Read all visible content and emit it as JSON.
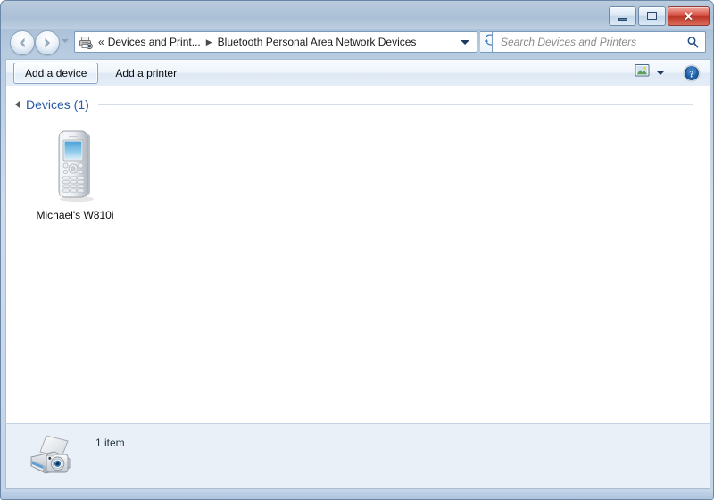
{
  "window": {
    "title": "",
    "controls": {
      "minimize_label": "Minimize",
      "maximize_label": "Maximize",
      "close_label": "✕"
    }
  },
  "navigation": {
    "back_label": "◀",
    "forward_label": "▶",
    "back_name": "back-button",
    "forward_name": "forward-button",
    "history_label": "Recent pages"
  },
  "address_bar": {
    "icon": "devices-and-printers-icon",
    "overflow_chevron": "«",
    "separator": "▶",
    "crumbs": [
      {
        "label": "Devices and Print..."
      },
      {
        "label": "Bluetooth Personal Area Network Devices"
      }
    ],
    "dropdown_label": "Previous locations",
    "refresh_label": "Refresh"
  },
  "search": {
    "placeholder": "Search Devices and Printers",
    "value": "",
    "icon": "search-icon"
  },
  "toolbar": {
    "add_device_label": "Add a device",
    "add_printer_label": "Add a printer",
    "view_icon": "preview-pane-icon",
    "view_caret_label": "Change your view",
    "help_icon": "help-icon",
    "help_label": "?"
  },
  "content": {
    "group": {
      "title": "Devices (1)",
      "expanded": true
    },
    "devices": [
      {
        "name": "Michael's W810i",
        "icon": "mobile-phone-icon"
      }
    ]
  },
  "status_bar": {
    "icon": "devices-and-printers-icon",
    "text": "1 item"
  },
  "colors": {
    "accent_blue": "#2b5ba8",
    "titlebar_top": "#9db5ce",
    "titlebar_bottom": "#c4d5e8",
    "close_red": "#bc3526",
    "status_bg": "#eaf0f8",
    "content_bg": "#ffffff"
  }
}
